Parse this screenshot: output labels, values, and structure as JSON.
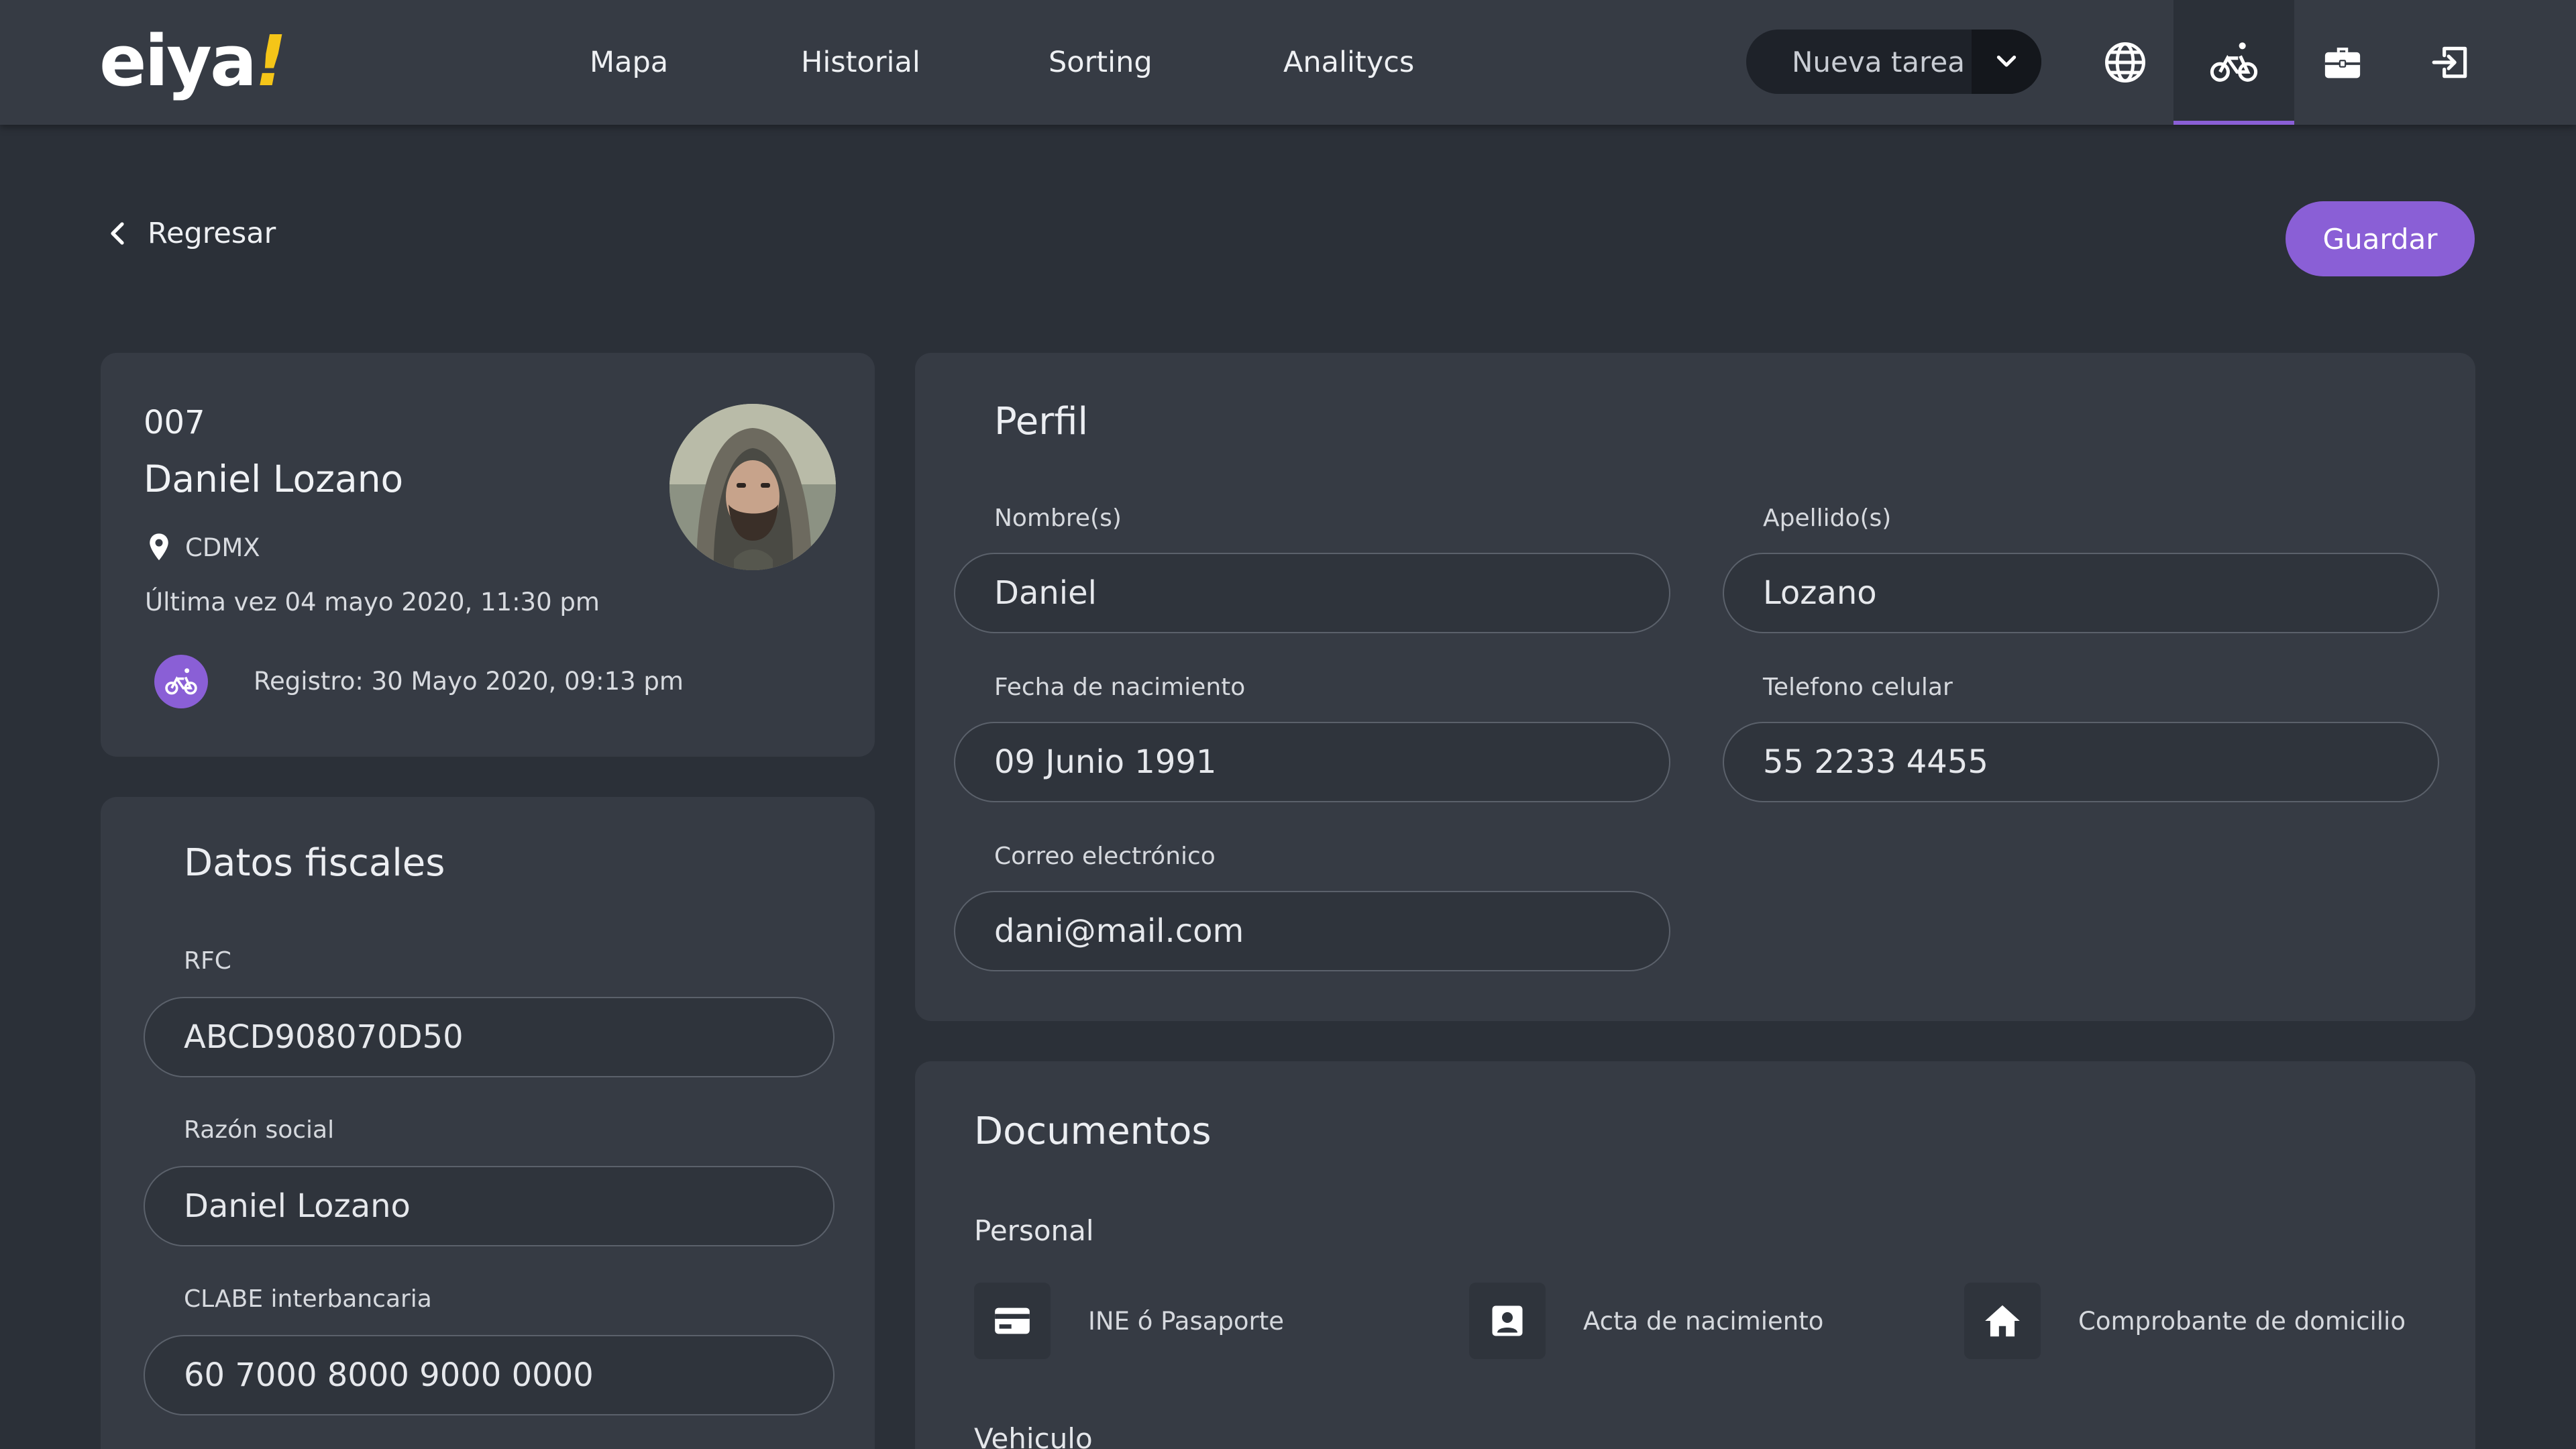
{
  "header": {
    "logo_text": "eiya",
    "logo_mark": "!",
    "nav": [
      "Mapa",
      "Historial",
      "Sorting",
      "Analitycs"
    ],
    "new_task_label": "Nueva tarea",
    "icons": [
      "globe-icon",
      "bike-icon",
      "briefcase-icon",
      "logout-icon"
    ],
    "active_icon": "bike-icon",
    "accent_color": "#8a5fd6"
  },
  "toolbar": {
    "back_label": "Regresar",
    "save_label": "Guardar"
  },
  "profile_card": {
    "id": "007",
    "name": "Daniel Lozano",
    "location": "CDMX",
    "last_seen": "Última vez 04 mayo 2020, 11:30 pm",
    "registration": "Registro: 30 Mayo 2020, 09:13 pm"
  },
  "fiscal": {
    "title": "Datos fiscales",
    "rfc_label": "RFC",
    "rfc_value": "ABCD908070D50",
    "razon_label": "Razón social",
    "razon_value": "Daniel Lozano",
    "clabe_label": "CLABE interbancaria",
    "clabe_value": "60 7000 8000 9000 0000"
  },
  "perfil": {
    "title": "Perfil",
    "nombre_label": "Nombre(s)",
    "nombre_value": "Daniel",
    "apellido_label": "Apellido(s)",
    "apellido_value": "Lozano",
    "fecha_label": "Fecha de nacimiento",
    "fecha_value": "09 Junio 1991",
    "telefono_label": "Telefono celular",
    "telefono_value": "55 2233 4455",
    "correo_label": "Correo electrónico",
    "correo_value": "dani@mail.com"
  },
  "documentos": {
    "title": "Documentos",
    "personal_label": "Personal",
    "items": [
      {
        "label": "INE ó Pasaporte",
        "icon": "credit-card-icon"
      },
      {
        "label": "Acta de nacimiento",
        "icon": "id-card-icon"
      },
      {
        "label": "Comprobante de domicilio",
        "icon": "home-icon"
      }
    ],
    "vehiculo_label": "Vehiculo"
  }
}
